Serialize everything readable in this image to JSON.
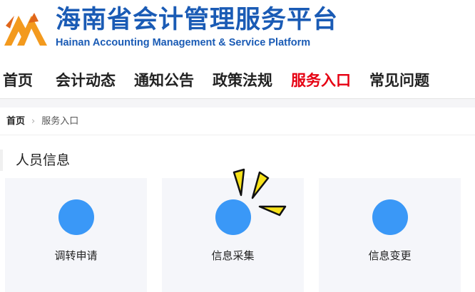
{
  "header": {
    "title_cn": "海南省会计管理服务平台",
    "title_en": "Hainan Accounting Management & Service Platform",
    "logo_icon": "accounting-logo-icon",
    "colors": {
      "brand": "#1a5bb5",
      "logo_orange": "#f39a1e"
    }
  },
  "nav": {
    "items": [
      {
        "label": "首页",
        "active": false
      },
      {
        "label": "会计动态",
        "active": false
      },
      {
        "label": "通知公告",
        "active": false
      },
      {
        "label": "政策法规",
        "active": false
      },
      {
        "label": "服务入口",
        "active": true
      },
      {
        "label": "常见问题",
        "active": false
      }
    ],
    "active_color": "#e60012"
  },
  "breadcrumb": {
    "home": "首页",
    "separator_icon": "chevron-right-icon",
    "current": "服务入口"
  },
  "section": {
    "title": "人员信息",
    "cards": [
      {
        "label": "调转申请",
        "icon": "circle-icon"
      },
      {
        "label": "信息采集",
        "icon": "circle-icon"
      },
      {
        "label": "信息变更",
        "icon": "circle-icon"
      }
    ],
    "card_icon_color": "#3a98f7"
  }
}
